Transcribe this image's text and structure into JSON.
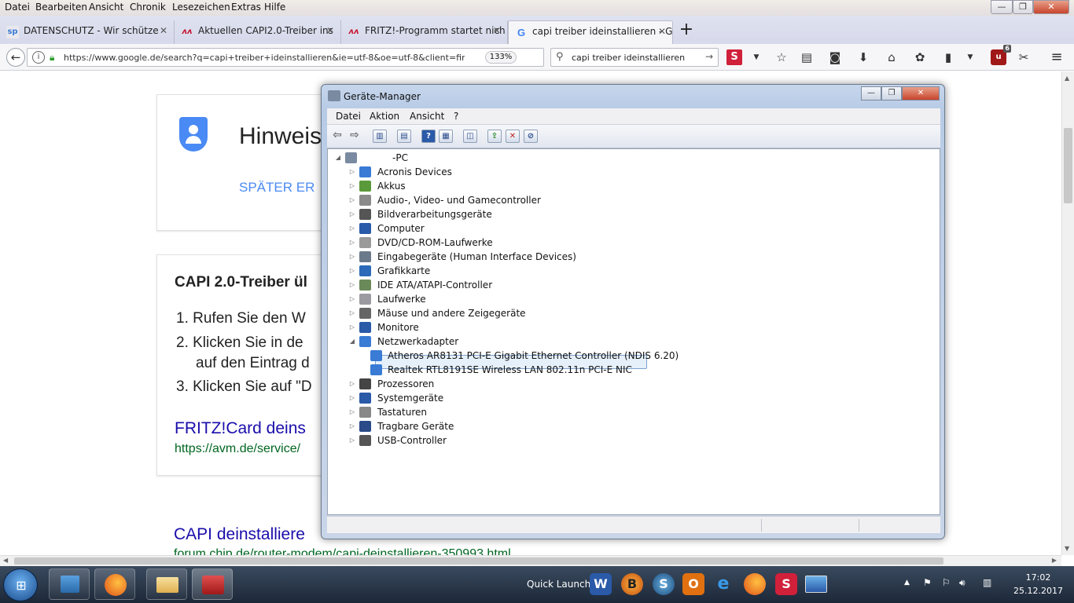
{
  "menubar": {
    "items": [
      "Datei",
      "Bearbeiten",
      "Ansicht",
      "Chronik",
      "Lesezeichen",
      "Extras",
      "Hilfe"
    ]
  },
  "tabs": [
    {
      "label": "DATENSCHUTZ - Wir schütze",
      "icon": "sp-favicon"
    },
    {
      "label": "Aktuellen CAPI2.0-Treiber ins",
      "icon": "avm-favicon"
    },
    {
      "label": "FRITZ!-Programm startet nich",
      "icon": "avm-favicon"
    },
    {
      "label": "capi treiber ideinstallieren - G",
      "icon": "google-favicon"
    }
  ],
  "nav": {
    "url": "https://www.google.de/search?q=capi+treiber+ideinstallieren&ie=utf-8&oe=utf-8&client=firef",
    "zoom": "133%",
    "search_query": "capi treiber ideinstallieren",
    "badge_count": "6"
  },
  "page": {
    "notice_title": "Hinweis",
    "later_link": "SPÄTER ER",
    "result_heading": "CAPI 2.0-Treiber ül",
    "steps": [
      "1. Rufen Sie den W",
      "2. Klicken Sie in de",
      "auf den Eintrag d",
      "3. Klicken Sie auf \"D"
    ],
    "link1_title": "FRITZ!Card deins",
    "link1_url": "https://avm.de/service/",
    "link2_title": "CAPI deinstalliere",
    "link2_url": "forum.chip.de/router-modem/capi-deinstallieren-350993.html"
  },
  "devmgr": {
    "title": "Geräte-Manager",
    "menu": [
      "Datei",
      "Aktion",
      "Ansicht",
      "?"
    ],
    "root": "-PC",
    "categories": [
      {
        "label": "Acronis Devices",
        "color": "#3a7bd5"
      },
      {
        "label": "Akkus",
        "color": "#5a9a3a"
      },
      {
        "label": "Audio-, Video- und Gamecontroller",
        "color": "#8a8a8a"
      },
      {
        "label": "Bildverarbeitungsgeräte",
        "color": "#555"
      },
      {
        "label": "Computer",
        "color": "#2a5aa8"
      },
      {
        "label": "DVD/CD-ROM-Laufwerke",
        "color": "#9a9a9a"
      },
      {
        "label": "Eingabegeräte (Human Interface Devices)",
        "color": "#6a7a8a"
      },
      {
        "label": "Grafikkarte",
        "color": "#2a6ab8"
      },
      {
        "label": "IDE ATA/ATAPI-Controller",
        "color": "#6a8a5a"
      },
      {
        "label": "Laufwerke",
        "color": "#9a9aa0"
      },
      {
        "label": "Mäuse und andere Zeigegeräte",
        "color": "#666"
      },
      {
        "label": "Monitore",
        "color": "#2a5aa8"
      },
      {
        "label": "Netzwerkadapter",
        "color": "#3a7bd5"
      }
    ],
    "network_children": [
      "Atheros AR8131 PCI-E Gigabit Ethernet Controller (NDIS 6.20)",
      "Realtek RTL8191SE Wireless LAN 802.11n PCI-E NIC"
    ],
    "categories_after": [
      {
        "label": "Prozessoren",
        "color": "#444"
      },
      {
        "label": "Systemgeräte",
        "color": "#2a5aa8"
      },
      {
        "label": "Tastaturen",
        "color": "#888"
      },
      {
        "label": "Tragbare Geräte",
        "color": "#2a4a88"
      },
      {
        "label": "USB-Controller",
        "color": "#555"
      }
    ]
  },
  "taskbar": {
    "quick_launch": "Quick Launch",
    "time": "17:02",
    "date": "25.12.2017"
  }
}
